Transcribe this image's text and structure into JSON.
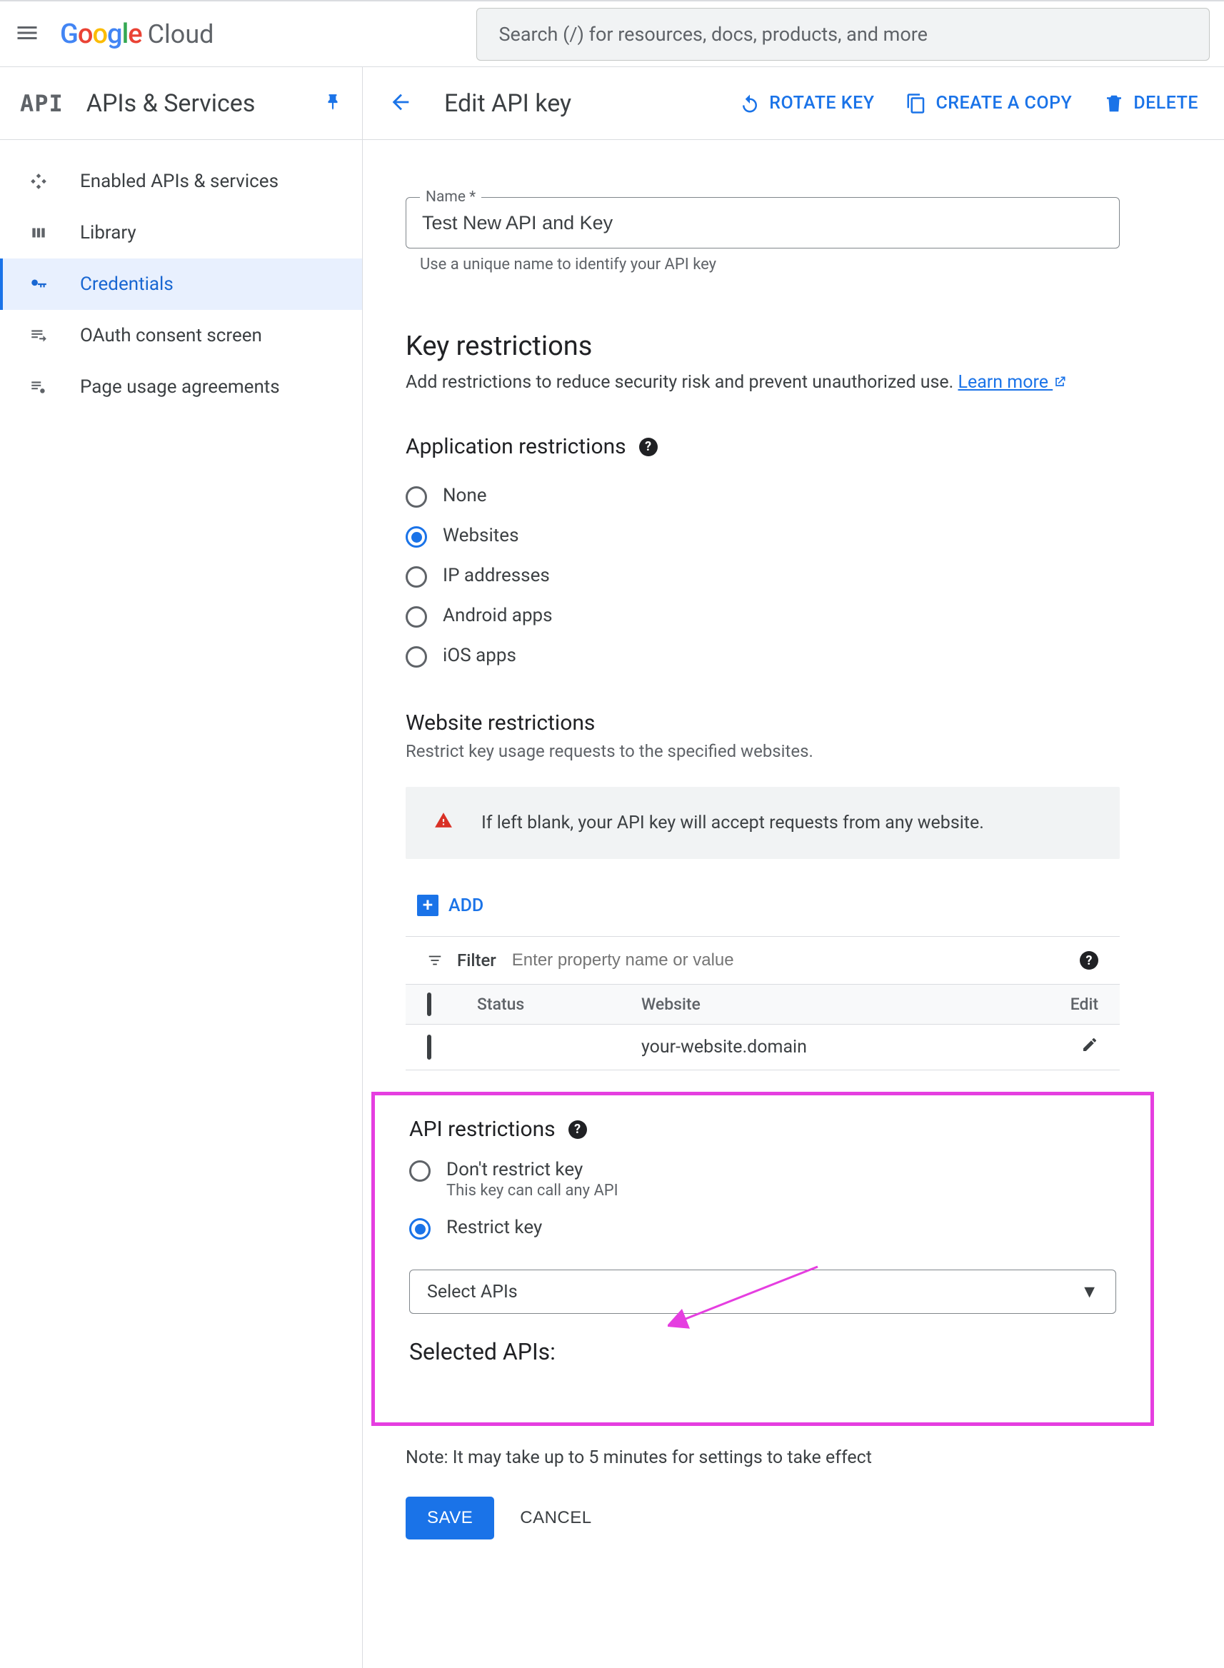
{
  "topbar": {
    "logo_cloud": "Cloud",
    "search_placeholder": "Search (/) for resources, docs, products, and more"
  },
  "sidebar": {
    "api_logo": "API",
    "title": "APIs & Services",
    "items": [
      {
        "label": "Enabled APIs & services"
      },
      {
        "label": "Library"
      },
      {
        "label": "Credentials"
      },
      {
        "label": "OAuth consent screen"
      },
      {
        "label": "Page usage agreements"
      }
    ]
  },
  "actions": {
    "page_title": "Edit API key",
    "rotate": "ROTATE KEY",
    "copy": "CREATE A COPY",
    "delete": "DELETE"
  },
  "form": {
    "name_label": "Name *",
    "name_value": "Test New API and Key",
    "name_helper": "Use a unique name to identify your API key",
    "key_restrictions_h": "Key restrictions",
    "key_restrictions_desc": "Add restrictions to reduce security risk and prevent unauthorized use. ",
    "learn_more": "Learn more",
    "app_restrictions_h": "Application restrictions",
    "app_options": [
      {
        "label": "None",
        "checked": false
      },
      {
        "label": "Websites",
        "checked": true
      },
      {
        "label": "IP addresses",
        "checked": false
      },
      {
        "label": "Android apps",
        "checked": false
      },
      {
        "label": "iOS apps",
        "checked": false
      }
    ],
    "website_restrictions_h": "Website restrictions",
    "website_restrictions_desc": "Restrict key usage requests to the specified websites.",
    "notice": "If left blank, your API key will accept requests from any website.",
    "add": "ADD",
    "filter_label": "Filter",
    "filter_placeholder": "Enter property name or value",
    "thead_status": "Status",
    "thead_website": "Website",
    "thead_edit": "Edit",
    "rows": [
      {
        "status": "",
        "website": "your-website.domain"
      }
    ],
    "api_restrictions_h": "API restrictions",
    "api_options": [
      {
        "label": "Don't restrict key",
        "sub": "This key can call any API",
        "checked": false
      },
      {
        "label": "Restrict key",
        "sub": "",
        "checked": true
      }
    ],
    "select_placeholder": "Select APIs",
    "selected_apis_h": "Selected APIs:",
    "note": "Note: It may take up to 5 minutes for settings to take effect",
    "save": "SAVE",
    "cancel": "CANCEL"
  }
}
